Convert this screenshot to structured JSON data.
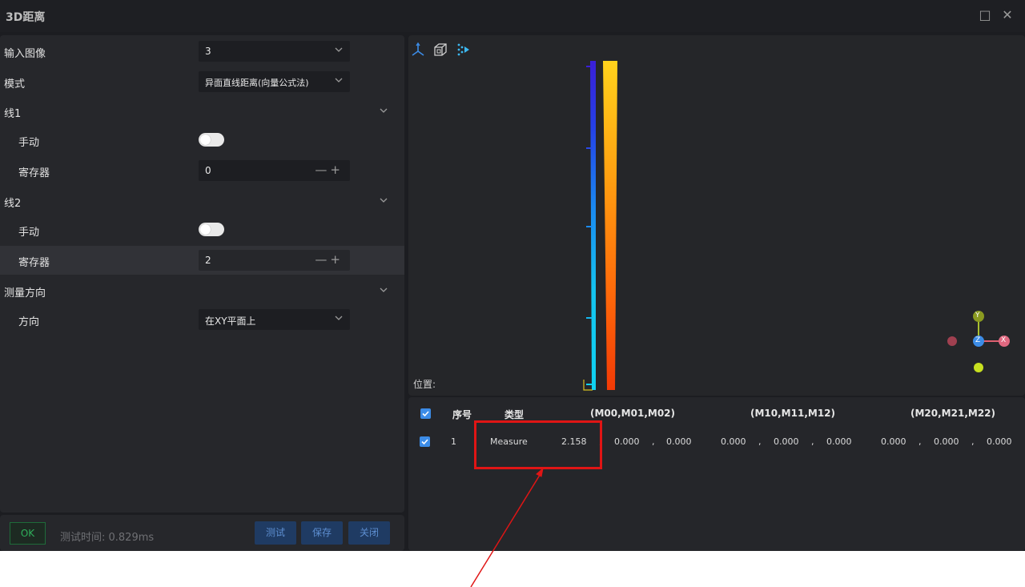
{
  "window": {
    "title": "3D距离",
    "maximize_icon": "□",
    "close_icon": "✕"
  },
  "params": {
    "input_image": {
      "label": "输入图像",
      "value": "3"
    },
    "mode": {
      "label": "模式",
      "value": "异面直线距离(向量公式法)"
    },
    "line1": {
      "label": "线1",
      "manual_label": "手动",
      "manual_on": false,
      "register_label": "寄存器",
      "register_value": "0"
    },
    "line2": {
      "label": "线2",
      "manual_label": "手动",
      "manual_on": false,
      "register_label": "寄存器",
      "register_value": "2"
    },
    "measure_direction": {
      "label": "测量方向",
      "direction_label": "方向",
      "direction_value": "在XY平面上"
    },
    "stepper_controls": "—+"
  },
  "footer": {
    "status": "OK",
    "status_color": "#2fae5b",
    "test_time": "测试时间: 0.829ms",
    "test_button": "测试",
    "save_button": "保存",
    "close_button": "关闭"
  },
  "viewer": {
    "position_label": "位置:",
    "axis_labels": {
      "y": "Y",
      "z": "Z",
      "x": "X"
    }
  },
  "table": {
    "headers": {
      "index": "序号",
      "type": "类型",
      "m0": "(M00,M01,M02)",
      "m1": "(M10,M11,M12)",
      "m2": "(M20,M21,M22)"
    },
    "row": {
      "checked": true,
      "index": "1",
      "type": "Measure",
      "value": "2.158",
      "sep": ",",
      "m00": "0.000",
      "m01": "0.000",
      "m10": "0.000",
      "m11": "0.000",
      "m12": "0.000",
      "m20": "0.000",
      "m21": "0.000",
      "m22": "0.000"
    }
  },
  "colors": {
    "accent": "#3c8ce7",
    "annotation": "#e01515",
    "background": "#1c1d21"
  }
}
